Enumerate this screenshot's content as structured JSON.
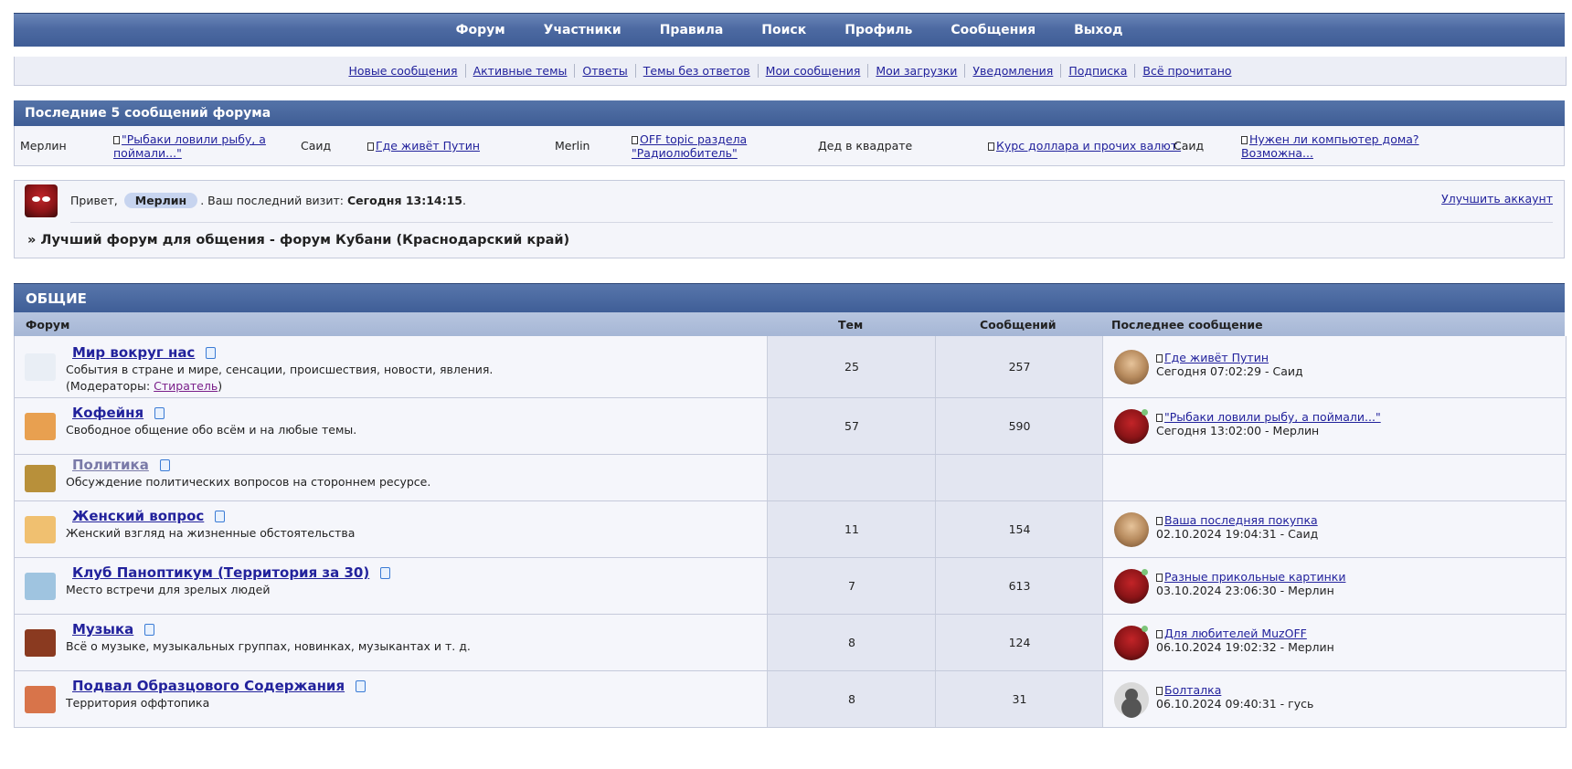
{
  "nav": {
    "main": [
      "Форум",
      "Участники",
      "Правила",
      "Поиск",
      "Профиль",
      "Сообщения",
      "Выход"
    ],
    "sub": [
      "Новые сообщения",
      "Активные темы",
      "Ответы",
      "Темы без ответов",
      "Мои сообщения",
      "Мои загрузки",
      "Уведомления",
      "Подписка",
      "Всё прочитано"
    ]
  },
  "last_posts": {
    "title": "Последние 5 сообщений форума",
    "items": [
      {
        "author": "Мерлин",
        "topic_line1": "\"Рыбаки ловили рыбу, а",
        "topic_line2": "поймали...\""
      },
      {
        "author": "Саид",
        "topic_line1": "Где живёт Путин",
        "topic_line2": ""
      },
      {
        "author": "Merlin",
        "topic_line1": "OFF topic раздела",
        "topic_line2": "\"Радиолюбитель\""
      },
      {
        "author": "Дед в квадрате",
        "topic_line1": "Курс доллара и прочих валют.",
        "topic_line2": ""
      },
      {
        "author": "Саид",
        "topic_line1": "Нужен ли компьютер дома?",
        "topic_line2": "Возможна..."
      }
    ]
  },
  "welcome": {
    "hello": "Привет,",
    "username": "Мерлин",
    "visit_text": ". Ваш последний визит:",
    "visit_time": "Сегодня 13:14:15",
    "visit_end": ".",
    "upgrade": "Улучшить аккаунт",
    "tagline": "» Лучший форум для общения - форум Кубани (Краснодарский край)"
  },
  "category": {
    "title": "ОБЩИЕ",
    "columns": {
      "forum": "Форум",
      "topics": "Тем",
      "posts": "Сообщений",
      "last": "Последнее сообщение"
    },
    "moderators_label": "(Модераторы:",
    "moderators_close": ")",
    "forums": [
      {
        "title": "Мир вокруг нас",
        "desc": "События в стране и мире, сенсации, происшествия, новости, явления.",
        "moderator": "Стиратель",
        "topics": "25",
        "posts": "257",
        "last_title": "Где живёт Путин",
        "last_meta": "Сегодня 07:02:29 - Саид",
        "avatar": "said",
        "icon": "newspaper-icon",
        "icon_color": "#e9eef5"
      },
      {
        "title": "Кофейня",
        "desc": "Свободное общение обо всём и на любые темы.",
        "moderator": "",
        "topics": "57",
        "posts": "590",
        "last_title": "\"Рыбаки ловили рыбу, а поймали...\"",
        "last_meta": "Сегодня 13:02:00 - Мерлин",
        "avatar": "merlin",
        "icon": "coffee-cup-icon",
        "icon_color": "#e8a050"
      },
      {
        "title": "Политика",
        "desc": "Обсуждение политических вопросов на стороннем ресурсе.",
        "moderator": "",
        "topics": "",
        "posts": "",
        "last_title": "",
        "last_meta": "",
        "avatar": "",
        "icon": "folder-arrows-icon",
        "icon_color": "#b8903a"
      },
      {
        "title": "Женский вопрос",
        "desc": "Женский взгляд на жизненные обстоятельства",
        "moderator": "",
        "topics": "11",
        "posts": "154",
        "last_title": "Ваша последняя покупка",
        "last_meta": "02.10.2024 19:04:31 - Саид",
        "avatar": "said",
        "icon": "woman-icon",
        "icon_color": "#f0c070"
      },
      {
        "title": "Клуб Паноптикум (Территория за 30)",
        "desc": "Место встречи для зрелых людей",
        "moderator": "",
        "topics": "7",
        "posts": "613",
        "last_title": "Разные прикольные картинки",
        "last_meta": "03.10.2024 23:06:30 - Мерлин",
        "avatar": "merlin",
        "icon": "sunglasses-man-icon",
        "icon_color": "#9fc4e0"
      },
      {
        "title": "Музыка",
        "desc": "Всё о музыке, музыкальных группах, новинках, музыкантах и т. д.",
        "moderator": "",
        "topics": "8",
        "posts": "124",
        "last_title": "Для любителей MuzOFF",
        "last_meta": "06.10.2024 19:02:32 - Мерлин",
        "avatar": "merlin",
        "icon": "speaker-icon",
        "icon_color": "#8a3a20"
      },
      {
        "title": "Подвал Образцового Содержания",
        "desc": "Территория оффтопика",
        "moderator": "",
        "topics": "8",
        "posts": "31",
        "last_title": "Болталка",
        "last_meta": "06.10.2024 09:40:31 - гусь",
        "avatar": "guest",
        "icon": "basement-icon",
        "icon_color": "#d8744a"
      }
    ]
  },
  "colors": {
    "header": "#4d6aa2",
    "link": "#22229c",
    "row_bg": "#f5f6fb",
    "count_bg": "#e3e6f1"
  }
}
